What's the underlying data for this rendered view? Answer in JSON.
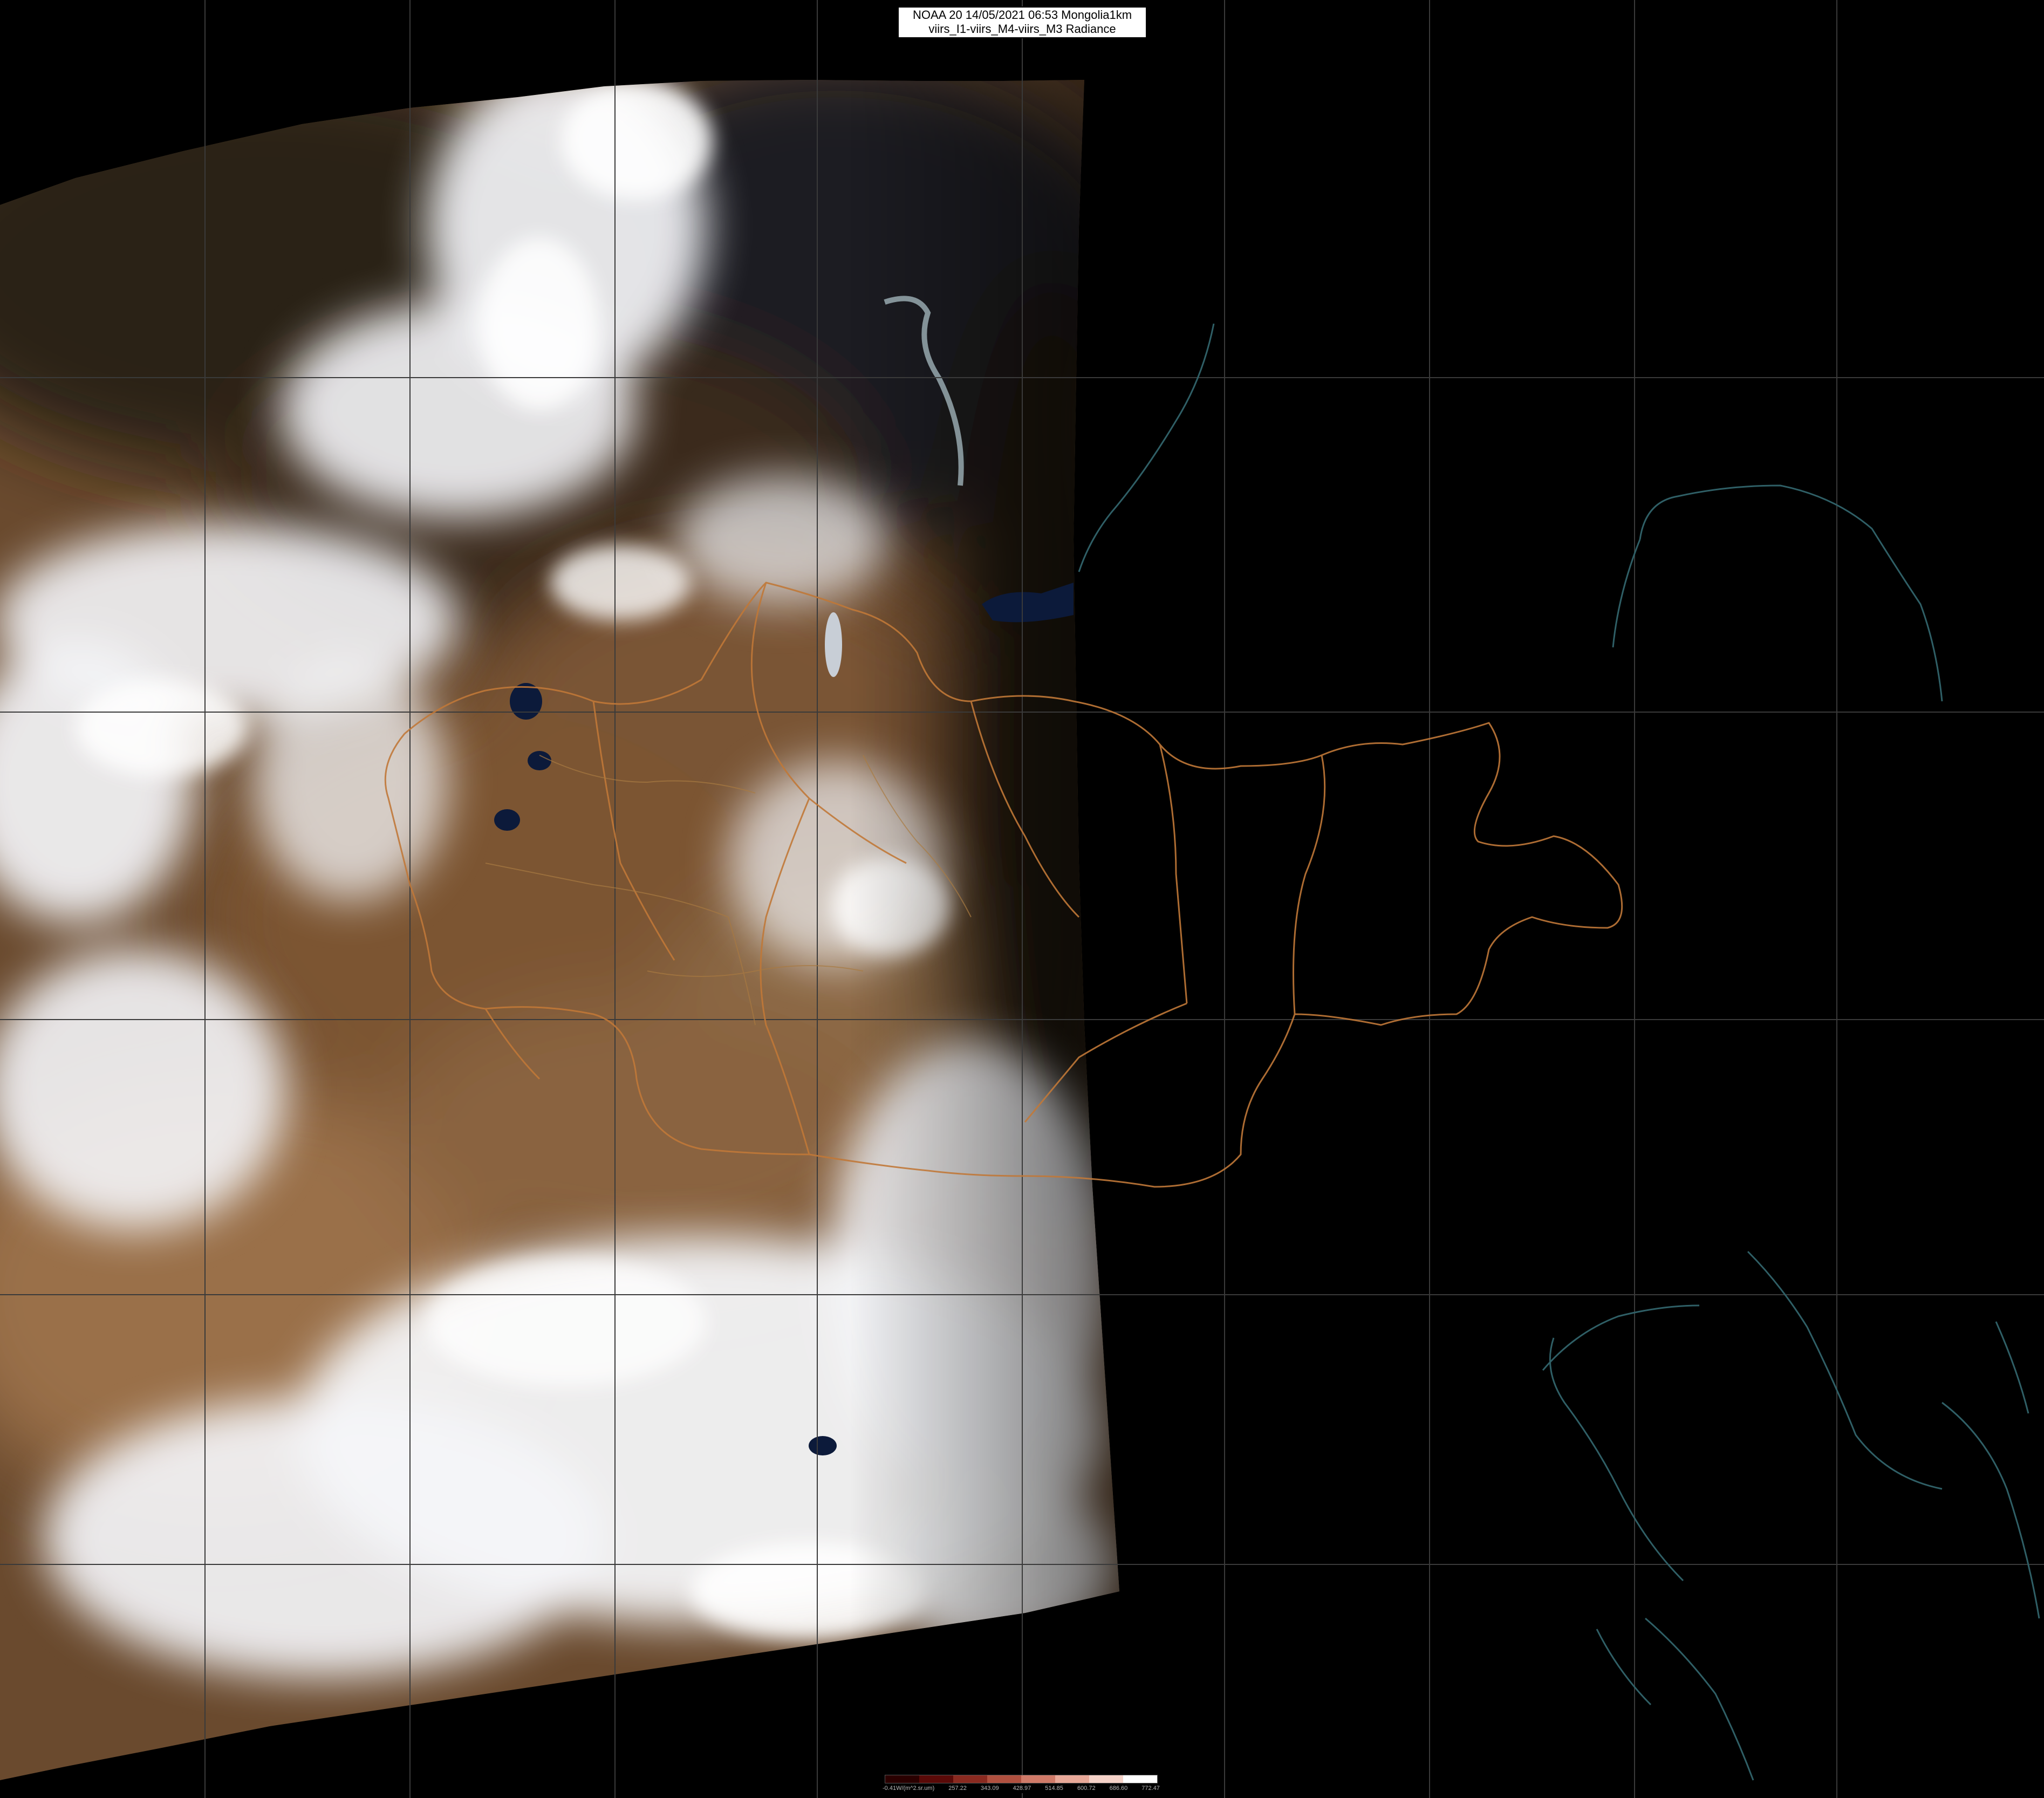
{
  "header": {
    "title_line1": "NOAA 20 14/05/2021 06:53 Mongolia1km",
    "title_line2": "viirs_I1-viirs_M4-viirs_M3 Radiance"
  },
  "colorbar": {
    "labels": [
      "-0.41W/(m^2.sr.um)",
      "257.22",
      "343.09",
      "428.97",
      "514.85",
      "600.72",
      "686.60",
      "772.47"
    ],
    "colors": [
      "#2a0000",
      "#5a0a08",
      "#8a2a20",
      "#b0503f",
      "#d07a68",
      "#e8a898",
      "#f5d2c8",
      "#ffffff"
    ]
  },
  "palette": {
    "background": "#000000",
    "graticule": "#3a3a3a",
    "admin_borders": "#c07838",
    "coastline": "#2f5f66",
    "cloud": "#ffffff",
    "desert": "#8a6238",
    "forest": "#2a2520"
  }
}
